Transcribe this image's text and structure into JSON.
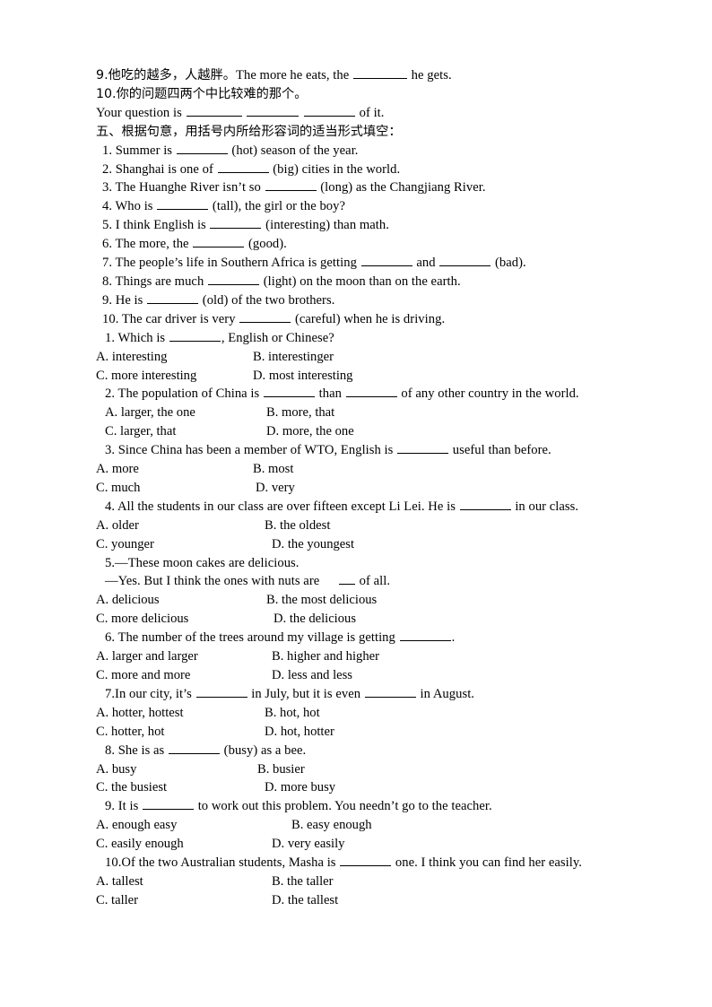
{
  "document": {
    "background_color": "#ffffff",
    "text_color": "#000000"
  },
  "translation_section": {
    "items": [
      {
        "id": "t9",
        "chinese": "9.他吃的越多，人越胖。",
        "english_before": "The more he eats, the ",
        "english_after": " he gets."
      },
      {
        "id": "t10",
        "chinese": "10.你的问题四两个中比较难的那个。"
      },
      {
        "id": "t10-answer",
        "english_before": "Your question is ",
        "english_mid1": " ",
        "english_mid2": " ",
        "english_after": " of it."
      }
    ]
  },
  "section_five": {
    "heading": "五、根据句意，用括号内所给形容词的适当形式填空：",
    "questions": [
      {
        "num": "1.",
        "before": " Summer is ",
        "after": " (hot) season of the year."
      },
      {
        "num": "2.",
        "before": " Shanghai is one of ",
        "after": " (big) cities in the world."
      },
      {
        "num": "3.",
        "before": " The Huanghe River isn’t so ",
        "after": " (long) as the Changjiang River."
      },
      {
        "num": "4.",
        "before": " Who is ",
        "after": " (tall), the girl or the boy?"
      },
      {
        "num": "5.",
        "before": " I think English is ",
        "after": " (interesting) than math."
      },
      {
        "num": "6.",
        "before": " The more, the ",
        "after": " (good)."
      },
      {
        "num": "7.",
        "before": " The people’s life in Southern Africa is getting ",
        "mid": " and ",
        "after": " (bad)."
      },
      {
        "num": "8.",
        "before": " Things are much ",
        "after": " (light) on the moon than on the earth."
      },
      {
        "num": "9.",
        "before": " He is ",
        "after": " (old) of the two brothers."
      },
      {
        "num": "10.",
        "before": " The car driver is very ",
        "after": " (careful) when he is driving."
      }
    ]
  },
  "multiple_choice": {
    "questions": [
      {
        "num": "1.",
        "stem_before": " Which is ",
        "stem_after": ", English or Chinese?",
        "options": [
          {
            "label": "A. interesting",
            "label2": "B. interestinger"
          },
          {
            "label": "C. more interesting",
            "label2": "D. most interesting"
          }
        ]
      },
      {
        "num": "2.",
        "stem_before": " The population of China is ",
        "stem_mid": " than ",
        "stem_after": " of any other country in the world.",
        "options": [
          {
            "label": "A. larger, the one",
            "label2": "B. more, that"
          },
          {
            "label": "C. larger, that",
            "label2": "D. more, the one"
          }
        ]
      },
      {
        "num": "3.",
        "stem_before": " Since China has been a member of WTO, English is ",
        "stem_after": " useful than before.",
        "options": [
          {
            "label": "A. more",
            "label2": "B. most"
          },
          {
            "label": "C. much",
            "label2": "D. very"
          }
        ]
      },
      {
        "num": "4.",
        "stem_before": " All the students in our class are over fifteen except Li Lei. He is ",
        "stem_after": " in our class.",
        "options": [
          {
            "label": "A. older",
            "label2": "B. the oldest"
          },
          {
            "label": "C. younger",
            "label2": "D. the youngest"
          }
        ]
      },
      {
        "num": "5.",
        "stem_line1": "—These moon cakes are delicious.",
        "stem_line2_before": "—Yes. But I think the ones with nuts are ",
        "stem_line2_after": " of all.",
        "options": [
          {
            "label": "A. delicious",
            "label2": "B. the most delicious"
          },
          {
            "label": "C. more delicious",
            "label2": "D. the delicious"
          }
        ]
      },
      {
        "num": "6.",
        "stem_before": " The number of the trees around my village is getting ",
        "stem_after": ".",
        "options": [
          {
            "label": "A. larger and larger",
            "label2": "B. higher and higher"
          },
          {
            "label": "C. more and more",
            "label2": "D. less and less"
          }
        ]
      },
      {
        "num": "7.",
        "stem_before": "In our city, it’s ",
        "stem_mid": " in July, but it is even ",
        "stem_after": " in August.",
        "options": [
          {
            "label": "A. hotter, hottest",
            "label2": "B. hot, hot"
          },
          {
            "label": "C. hotter, hot",
            "label2": "D. hot, hotter"
          }
        ]
      },
      {
        "num": "8.",
        "stem_before": " She is as ",
        "stem_after": " (busy) as a bee.",
        "options": [
          {
            "label": "A. busy",
            "label2": "B. busier"
          },
          {
            "label": "C. the busiest",
            "label2": "D. more busy"
          }
        ]
      },
      {
        "num": "9.",
        "stem_before": " It is ",
        "stem_after": " to work out this problem. You needn’t go to the teacher.",
        "options": [
          {
            "label": "A. enough easy",
            "label2": "B. easy enough"
          },
          {
            "label": "C. easily enough",
            "label2": "D. very easily"
          }
        ]
      },
      {
        "num": "10.",
        "stem_before": "Of the two Australian students, Masha is ",
        "stem_after": " one. I think you can find her easily.",
        "options": [
          {
            "label": "A. tallest",
            "label2": "B. the taller"
          },
          {
            "label": "C. taller",
            "label2": "D. the tallest"
          }
        ]
      }
    ]
  }
}
